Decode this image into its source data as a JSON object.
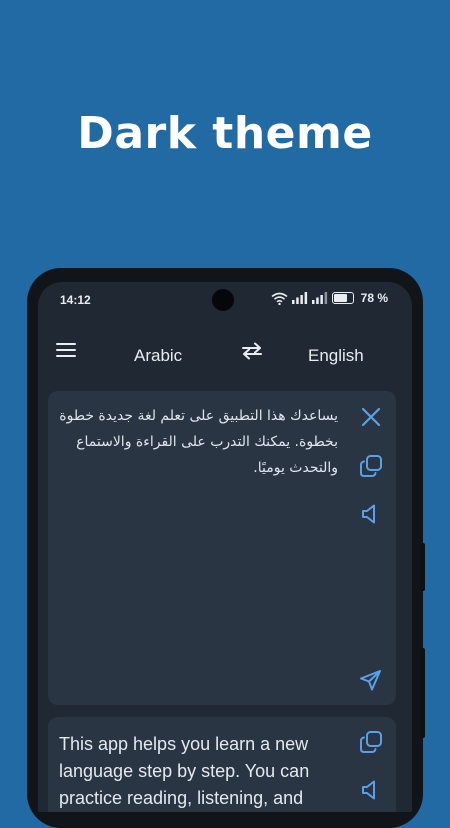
{
  "promo": {
    "title": "Dark theme"
  },
  "status": {
    "time": "14:12",
    "battery_label": "78 %",
    "battery_level": 0.78
  },
  "toolbar": {
    "source_language": "Arabic",
    "target_language": "English"
  },
  "source": {
    "text": "يساعدك هذا التطبيق على تعلم لغة جديدة خطوة بخطوة. يمكنك التدرب على القراءة والاستماع والتحدث يوميًا."
  },
  "translation": {
    "text": "This app helps you learn a new language step by step. You can practice reading, listening, and speaking every day."
  },
  "icons": {
    "menu": "menu-icon",
    "swap": "swap-icon",
    "clear": "close-icon",
    "copy": "copy-icon",
    "speak": "speaker-icon",
    "send": "send-icon",
    "accent": "#5aa0e8"
  }
}
